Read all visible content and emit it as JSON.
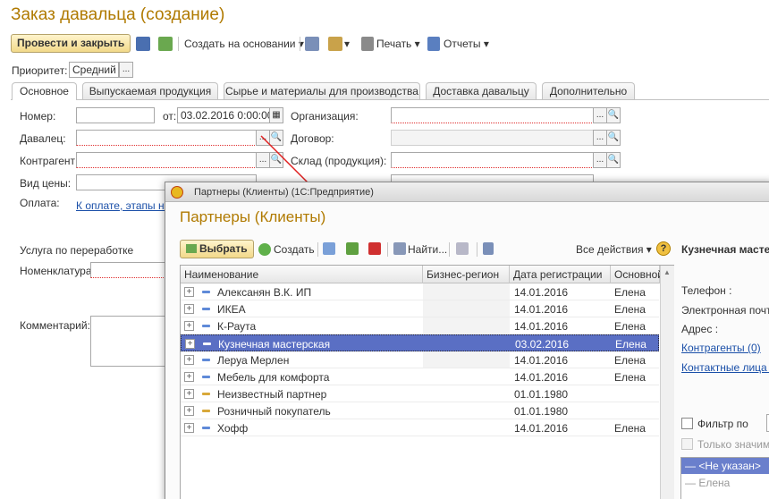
{
  "window": {
    "title": "Заказ давальца (создание)"
  },
  "toolbar": {
    "post_close": "Провести и закрыть",
    "create_based": "Создать на основании",
    "print": "Печать",
    "reports": "Отчеты"
  },
  "priority": {
    "label": "Приоритет:",
    "value": "Средний"
  },
  "tabs": [
    "Основное",
    "Выпускаемая продукция",
    "Сырье и материалы для производства",
    "Доставка давальцу",
    "Дополнительно"
  ],
  "form": {
    "number_label": "Номер:",
    "from_label": "от:",
    "date_value": "03.02.2016  0:00:00",
    "org_label": "Организация:",
    "supplier_label": "Давалец:",
    "contract_label": "Договор:",
    "counterparty_label": "Контрагент:",
    "warehouse_label": "Склад (продукция):",
    "price_label": "Вид цены:",
    "payment_label": "Оплата:",
    "payment_link": "К оплате, этапы не",
    "service_label": "Услуга по переработке",
    "nomenclature_label": "Номенклатура:",
    "comment_label": "Комментарий:"
  },
  "dialog": {
    "window_title": "Партнеры (Клиенты)  (1С:Предприятие)",
    "heading": "Партнеры (Клиенты)",
    "select": "Выбрать",
    "create": "Создать",
    "find": "Найти...",
    "all_actions": "Все действия",
    "columns": [
      "Наименование",
      "Бизнес-регион",
      "Дата регистрации",
      "Основной"
    ],
    "rows": [
      {
        "name": "Алексанян В.К. ИП",
        "date": "14.01.2016",
        "main": "Елена"
      },
      {
        "name": "ИКЕА",
        "date": "14.01.2016",
        "main": "Елена"
      },
      {
        "name": "К-Раута",
        "date": "14.01.2016",
        "main": "Елена"
      },
      {
        "name": "Кузнечная мастерская",
        "date": "03.02.2016",
        "main": "Елена"
      },
      {
        "name": "Леруа Мерлен",
        "date": "14.01.2016",
        "main": "Елена"
      },
      {
        "name": "Мебель для комфорта",
        "date": "14.01.2016",
        "main": "Елена"
      },
      {
        "name": "Неизвестный партнер",
        "date": "01.01.1980",
        "main": ""
      },
      {
        "name": "Розничный покупатель",
        "date": "01.01.1980",
        "main": ""
      },
      {
        "name": "Хофф",
        "date": "14.01.2016",
        "main": "Елена"
      }
    ],
    "side": {
      "title": "Кузнечная масте",
      "phone": "Телефон :",
      "email": "Электронная почта",
      "address": "Адрес :",
      "counterparties": "Контрагенты (0)",
      "contacts": "Контактные лица (0",
      "filter": "Фильтр по",
      "only_significant": "Только значим",
      "list": [
        "<Не указан>",
        "Елена"
      ]
    }
  },
  "colors": {
    "accent": "#b07a00",
    "selection": "#5a6fc4",
    "link": "#1a4fa8"
  }
}
